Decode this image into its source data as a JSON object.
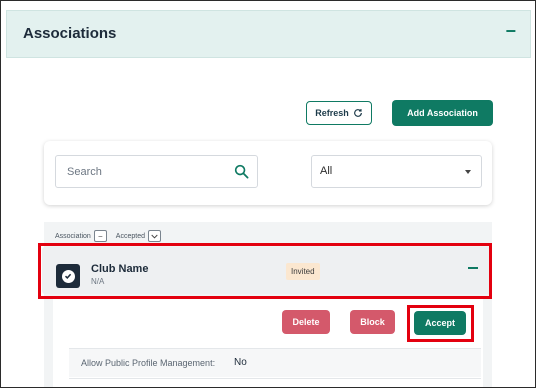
{
  "section": {
    "title": "Associations",
    "collapse_glyph": "−"
  },
  "toolbar": {
    "refresh_label": "Refresh",
    "add_label": "Add Association"
  },
  "filters": {
    "search_placeholder": "Search",
    "status_value": "All"
  },
  "table": {
    "headers": [
      {
        "label": "Association",
        "sort_glyph": "−"
      },
      {
        "label": "Accepted"
      }
    ]
  },
  "row": {
    "name": "Club Name",
    "subtitle": "N/A",
    "badge": "Invited",
    "actions": {
      "delete": "Delete",
      "block": "Block",
      "accept": "Accept"
    },
    "details": [
      {
        "label": "Allow Public Profile Management:",
        "value": "No"
      }
    ]
  },
  "colors": {
    "accent": "#0f7a63",
    "header_bg": "#e3f1ef",
    "danger": "#d4596b",
    "badge_bg": "#fbe7d0",
    "highlight": "#e3000f"
  },
  "icons": {
    "refresh": "refresh-icon",
    "search": "search-icon",
    "select_caret": "caret-down-icon",
    "row_check": "check-circle-icon"
  }
}
